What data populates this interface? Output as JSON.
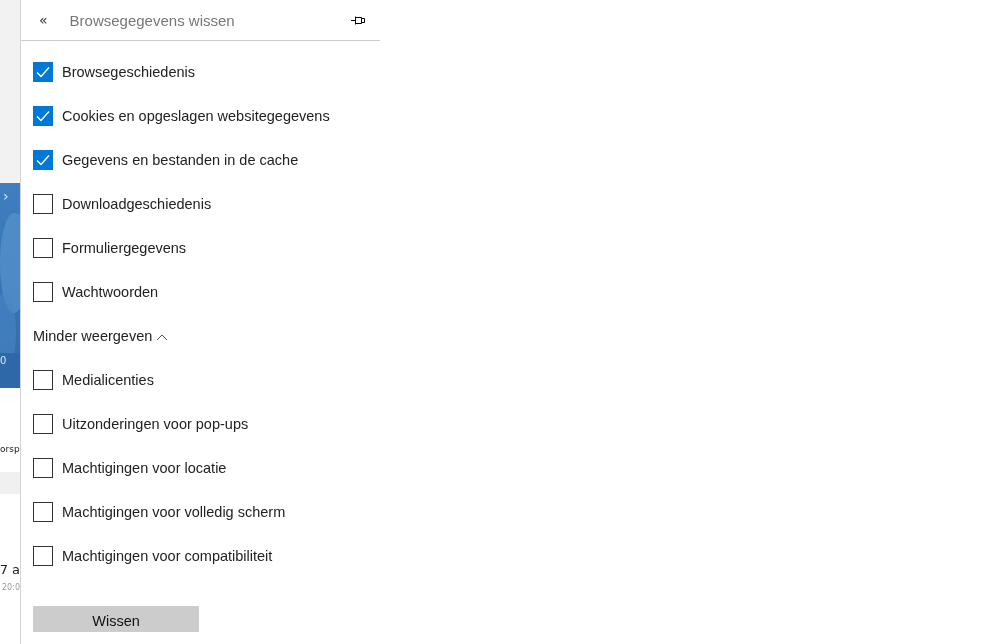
{
  "background": {
    "fragments": [
      {
        "kind": "picture",
        "chevron": "›",
        "caption": "0"
      },
      {
        "kind": "text",
        "text": "orsp"
      },
      {
        "kind": "band"
      },
      {
        "kind": "date",
        "day": "7 a",
        "time": "20:0"
      }
    ]
  },
  "panel": {
    "back": "«",
    "title": "Browsegegevens wissen",
    "items": [
      {
        "kind": "checkbox",
        "label": "Browsegeschiedenis",
        "checked": true
      },
      {
        "kind": "checkbox",
        "label": "Cookies en opgeslagen websitegegevens",
        "checked": true
      },
      {
        "kind": "checkbox",
        "label": "Gegevens en bestanden in de cache",
        "checked": true
      },
      {
        "kind": "checkbox",
        "label": "Downloadgeschiedenis",
        "checked": false
      },
      {
        "kind": "checkbox",
        "label": "Formuliergegevens",
        "checked": false
      },
      {
        "kind": "checkbox",
        "label": "Wachtwoorden",
        "checked": false
      },
      {
        "kind": "toggle",
        "label": "Minder weergeven",
        "expanded": true
      },
      {
        "kind": "checkbox",
        "label": "Medialicenties",
        "checked": false
      },
      {
        "kind": "checkbox",
        "label": "Uitzonderingen voor pop-ups",
        "checked": false
      },
      {
        "kind": "checkbox",
        "label": "Machtigingen voor locatie",
        "checked": false
      },
      {
        "kind": "checkbox",
        "label": "Machtigingen voor volledig scherm",
        "checked": false
      },
      {
        "kind": "checkbox",
        "label": "Machtigingen voor compatibiliteit",
        "checked": false
      }
    ],
    "button": "Wissen"
  }
}
